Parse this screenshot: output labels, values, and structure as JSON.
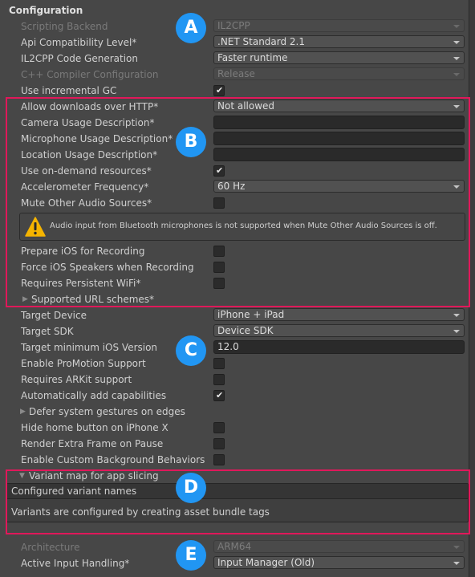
{
  "section": {
    "title": "Configuration"
  },
  "colors": {
    "accent_badge": "#2196f3",
    "highlight": "#e0185a",
    "warning": "#f5b400"
  },
  "badges": [
    "A",
    "B",
    "C",
    "D",
    "E"
  ],
  "rows": {
    "scripting_backend": {
      "label": "Scripting Backend",
      "value": "IL2CPP"
    },
    "api_compat": {
      "label": "Api Compatibility Level*",
      "value": ".NET Standard 2.1"
    },
    "il2cpp_codegen": {
      "label": "IL2CPP Code Generation",
      "value": "Faster runtime"
    },
    "cpp_compiler": {
      "label": "C++ Compiler Configuration",
      "value": "Release"
    },
    "incremental_gc": {
      "label": "Use incremental GC",
      "checked": true
    },
    "allow_http": {
      "label": "Allow downloads over HTTP*",
      "value": "Not allowed"
    },
    "camera_usage": {
      "label": "Camera Usage Description*",
      "value": ""
    },
    "microphone_usage": {
      "label": "Microphone Usage Description*",
      "value": ""
    },
    "location_usage": {
      "label": "Location Usage Description*",
      "value": ""
    },
    "on_demand": {
      "label": "Use on-demand resources*",
      "checked": true
    },
    "accelerometer": {
      "label": "Accelerometer Frequency*",
      "value": "60 Hz"
    },
    "mute_audio": {
      "label": "Mute Other Audio Sources*",
      "checked": false
    },
    "warning": {
      "icon": "warning-icon",
      "text": "Audio input from Bluetooth microphones is not supported when Mute Other Audio Sources is off."
    },
    "prepare_recording": {
      "label": "Prepare iOS for Recording",
      "checked": false
    },
    "force_speakers": {
      "label": "Force iOS Speakers when Recording",
      "checked": false
    },
    "persistent_wifi": {
      "label": "Requires Persistent WiFi*",
      "checked": false
    },
    "url_schemes": {
      "label": "Supported URL schemes*"
    },
    "target_device": {
      "label": "Target Device",
      "value": "iPhone + iPad"
    },
    "target_sdk": {
      "label": "Target SDK",
      "value": "Device SDK"
    },
    "min_ios": {
      "label": "Target minimum iOS Version",
      "value": "12.0"
    },
    "promotion": {
      "label": "Enable ProMotion Support",
      "checked": false
    },
    "arkit": {
      "label": "Requires ARKit support",
      "checked": false
    },
    "auto_caps": {
      "label": "Automatically add capabilities",
      "checked": true
    },
    "defer_gestures": {
      "label": "Defer system gestures on edges"
    },
    "hide_home": {
      "label": "Hide home button on iPhone X",
      "checked": false
    },
    "extra_frame": {
      "label": "Render Extra Frame on Pause",
      "checked": false
    },
    "custom_bg": {
      "label": "Enable Custom Background Behaviors",
      "checked": false
    },
    "variant_map": {
      "label": "Variant map for app slicing",
      "header": "Configured variant names",
      "body": "Variants are configured by creating asset bundle tags"
    },
    "architecture": {
      "label": "Architecture",
      "value": "ARM64"
    },
    "input_handling": {
      "label": "Active Input Handling*",
      "value": "Input Manager (Old)"
    }
  },
  "check_glyph": "✔"
}
